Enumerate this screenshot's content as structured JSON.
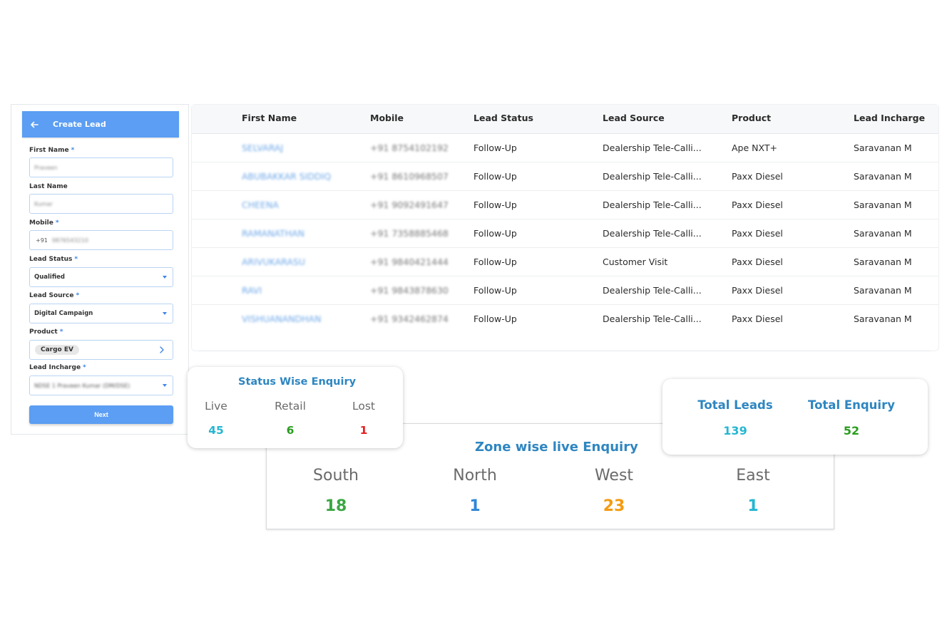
{
  "create_lead": {
    "title": "Create Lead",
    "fields": {
      "first_name": {
        "label": "First Name",
        "required": "*",
        "value": "Praveen"
      },
      "last_name": {
        "label": "Last Name",
        "value": "Kumar"
      },
      "mobile": {
        "label": "Mobile",
        "required": "*",
        "prefix": "+91",
        "value": "9876543210"
      },
      "lead_status": {
        "label": "Lead Status",
        "required": "*",
        "value": "Qualified"
      },
      "lead_source": {
        "label": "Lead Source",
        "required": "*",
        "value": "Digital Campaign"
      },
      "product": {
        "label": "Product",
        "required": "*",
        "value": "Cargo EV"
      },
      "lead_incharge": {
        "label": "Lead Incharge",
        "required": "*",
        "value": "NDSE 1 Praveen Kumar (DM/DSE)"
      }
    },
    "next_label": "Next"
  },
  "leads_table": {
    "columns": [
      "First Name",
      "Mobile",
      "Lead Status",
      "Lead Source",
      "Product",
      "Lead Incharge"
    ],
    "rows": [
      {
        "first_name": "SELVARAJ",
        "mobile": "+91 8754102192",
        "status": "Follow-Up",
        "source": "Dealership Tele-Calli...",
        "product": "Ape NXT+",
        "incharge": "Saravanan M"
      },
      {
        "first_name": "ABUBAKKAR SIDDIQ",
        "mobile": "+91 8610968507",
        "status": "Follow-Up",
        "source": "Dealership Tele-Calli...",
        "product": "Paxx Diesel",
        "incharge": "Saravanan M"
      },
      {
        "first_name": "CHEENA",
        "mobile": "+91 9092491647",
        "status": "Follow-Up",
        "source": "Dealership Tele-Calli...",
        "product": "Paxx Diesel",
        "incharge": "Saravanan M"
      },
      {
        "first_name": "RAMANATHAN",
        "mobile": "+91 7358885468",
        "status": "Follow-Up",
        "source": "Dealership Tele-Calli...",
        "product": "Paxx Diesel",
        "incharge": "Saravanan M"
      },
      {
        "first_name": "ARIVUKARASU",
        "mobile": "+91 9840421444",
        "status": "Follow-Up",
        "source": "Customer Visit",
        "product": "Paxx Diesel",
        "incharge": "Saravanan M"
      },
      {
        "first_name": "RAVI",
        "mobile": "+91 9843878630",
        "status": "Follow-Up",
        "source": "Dealership Tele-Calli...",
        "product": "Paxx Diesel",
        "incharge": "Saravanan M"
      },
      {
        "first_name": "VISHUANANDHAN",
        "mobile": "+91 9342462874",
        "status": "Follow-Up",
        "source": "Dealership Tele-Calli...",
        "product": "Paxx Diesel",
        "incharge": "Saravanan M"
      }
    ]
  },
  "status_card": {
    "title": "Status Wise Enquiry",
    "items": [
      {
        "label": "Live",
        "value": "45",
        "color": "#26b6d1"
      },
      {
        "label": "Retail",
        "value": "6",
        "color": "#2a9d1f"
      },
      {
        "label": "Lost",
        "value": "1",
        "color": "#e52222"
      }
    ]
  },
  "totals_card": {
    "items": [
      {
        "label": "Total Leads",
        "value": "139",
        "color": "#26b6d1"
      },
      {
        "label": "Total Enquiry",
        "value": "52",
        "color": "#2a9d1f"
      }
    ]
  },
  "zone_card": {
    "title": "Zone wise live Enquiry",
    "items": [
      {
        "label": "South",
        "value": "18",
        "color": "#3aa743"
      },
      {
        "label": "North",
        "value": "1",
        "color": "#2f86d8"
      },
      {
        "label": "West",
        "value": "23",
        "color": "#f39c12"
      },
      {
        "label": "East",
        "value": "1",
        "color": "#26b6d1"
      }
    ]
  },
  "colors": {
    "accent": "#5b9ef3",
    "title_blue": "#2e86c1"
  }
}
